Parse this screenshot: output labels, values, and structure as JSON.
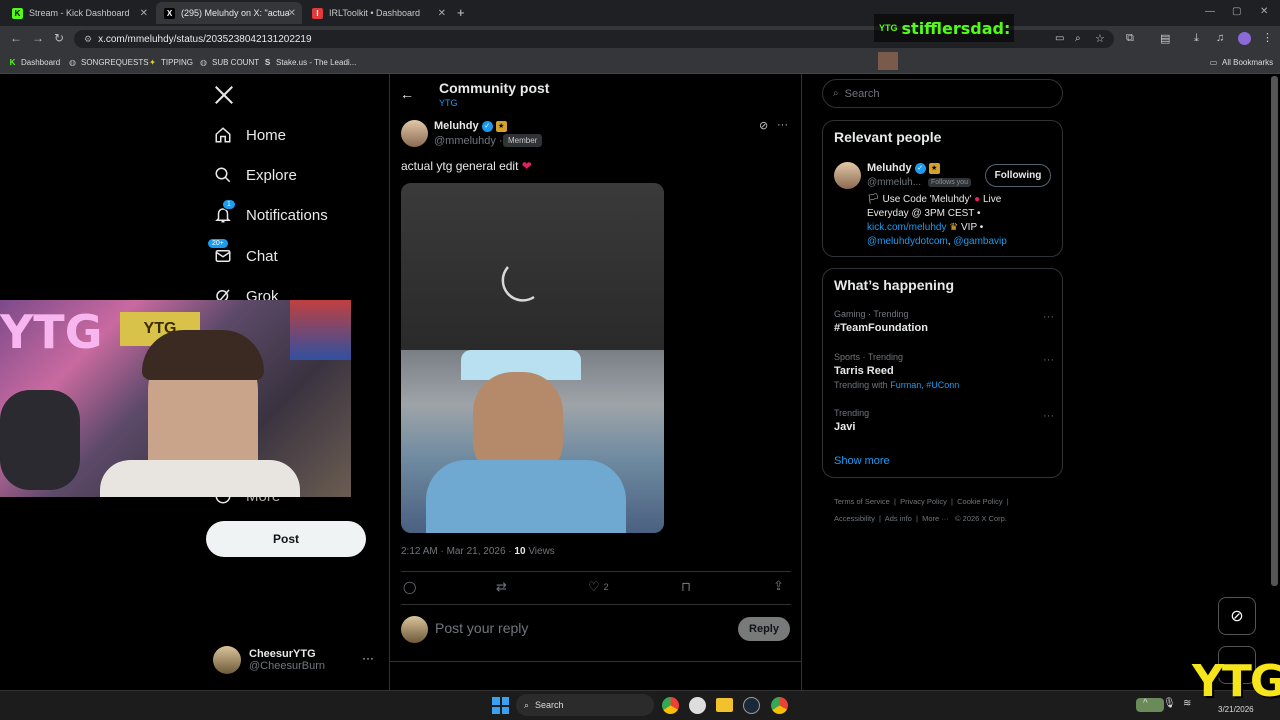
{
  "browser": {
    "tabs": [
      {
        "title": "Stream - Kick Dashboard",
        "icon": "kick-icon"
      },
      {
        "title": "(295) Meluhdy on X: \"actual",
        "icon": "x-logo-icon"
      },
      {
        "title": "IRLToolkit • Dashboard",
        "icon": "irltoolkit-icon"
      }
    ],
    "url": "x.com/mmeluhdy/status/2035238042131202219",
    "bookmarks": [
      "Dashboard",
      "SONGREQUESTS",
      "TIPPING",
      "SUB COUNT",
      "Stake.us - The Leadi..."
    ],
    "all_bookmarks": "All Bookmarks"
  },
  "overlay": {
    "chat_user": "stifflersdad:",
    "watermark": "YTG"
  },
  "sidebar": {
    "nav": [
      {
        "label": "Home",
        "icon": "home-icon"
      },
      {
        "label": "Explore",
        "icon": "search-icon"
      },
      {
        "label": "Notifications",
        "icon": "bell-icon",
        "badge": "1"
      },
      {
        "label": "Chat",
        "icon": "mail-icon",
        "badge": "20+"
      },
      {
        "label": "Grok",
        "icon": "grok-icon"
      },
      {
        "label": "More",
        "icon": "more-circle-icon"
      }
    ],
    "post_button": "Post",
    "account": {
      "name": "CheesurYTG",
      "handle": "@CheesurBurn"
    }
  },
  "main": {
    "header_title": "Community post",
    "header_sub": "YTG",
    "post": {
      "author": "Meluhdy",
      "handle": "@mmeluhdy ·",
      "member_badge": "Member",
      "text": "actual ytg general edit",
      "timestamp": "2:12 AM · Mar 21, 2026 ·",
      "views_count": "10",
      "views_label": "Views",
      "likes": "2"
    },
    "reply_placeholder": "Post your reply",
    "reply_button": "Reply"
  },
  "right": {
    "search_placeholder": "Search",
    "relevant_title": "Relevant people",
    "person": {
      "name": "Meluhdy",
      "handle": "@mmeluh...",
      "follows_you": "Follows you",
      "follow_button": "Following",
      "bio_1": "Use Code 'Meluhdy'",
      "bio_2": "Live",
      "bio_3": "Everyday @ 3PM CEST •",
      "bio_link": "kick.com/meluhdy",
      "bio_vip": "VIP •",
      "bio_m1": "@meluhdydotcom",
      "bio_m2": "@gambavip"
    },
    "happening_title": "What’s happening",
    "trends": [
      {
        "meta": "Gaming · Trending",
        "name": "#TeamFoundation"
      },
      {
        "meta": "Sports · Trending",
        "name": "Tarris Reed",
        "with_label": "Trending with",
        "with_links": "Furman, #UConn"
      },
      {
        "meta": "Trending",
        "name": "Javi"
      }
    ],
    "show_more": "Show more",
    "footer": [
      "Terms of Service",
      "Privacy Policy",
      "Cookie Policy",
      "Accessibility",
      "Ads info",
      "More ···",
      "© 2026 X Corp."
    ]
  },
  "taskbar": {
    "search": "Search",
    "date": "3/21/2026"
  }
}
